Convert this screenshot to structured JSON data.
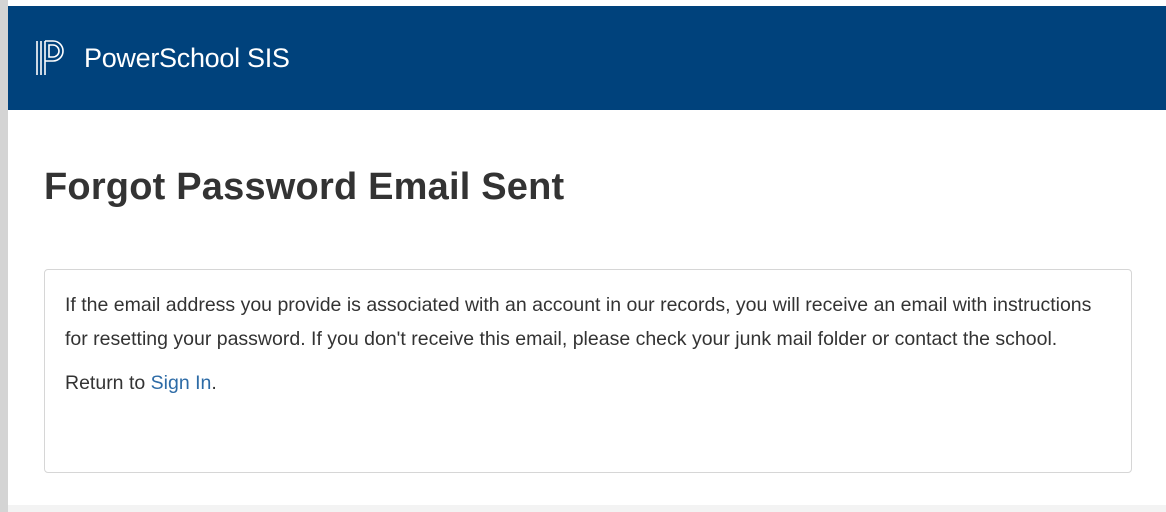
{
  "header": {
    "brand": "PowerSchool SIS",
    "logo_icon": "powerschool-logo-icon",
    "background_color": "#00427c"
  },
  "main": {
    "title": "Forgot Password Email Sent",
    "message": "If the email address you provide is associated with an account in our records, you will receive an email with instructions for resetting your password. If you don't receive this email, please check your junk mail folder or contact the school.",
    "return_prefix": "Return to ",
    "signin_link": "Sign In",
    "return_suffix": ".",
    "link_color": "#2d6ba6"
  }
}
